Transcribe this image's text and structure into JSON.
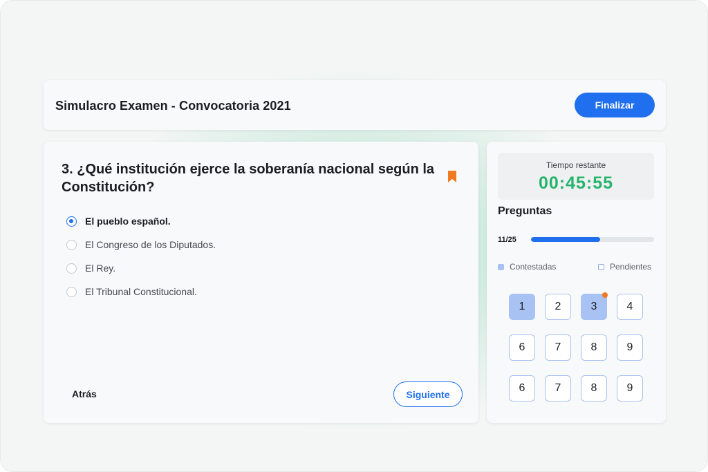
{
  "header": {
    "title": "Simulacro Examen - Convocatoria 2021",
    "finish_label": "Finalizar"
  },
  "question": {
    "text": "3. ¿Qué institución ejerce la soberanía nacional según la Constitución?",
    "bookmark_icon": "bookmark-icon",
    "options": [
      {
        "label": "El pueblo español.",
        "selected": true
      },
      {
        "label": "El Congreso de los Diputados.",
        "selected": false
      },
      {
        "label": "El Rey.",
        "selected": false
      },
      {
        "label": "El Tribunal Constitucional.",
        "selected": false
      }
    ],
    "back_label": "Atrás",
    "next_label": "Siguiente"
  },
  "sidebar": {
    "timer_label": "Tiempo restante",
    "timer_value": "00:45:55",
    "title": "Preguntas",
    "progress_label": "11/25",
    "progress_fraction": 0.56,
    "legend_answered": "Contestadas",
    "legend_pending": "Pendientes",
    "questions": [
      {
        "label": "1",
        "answered": true,
        "flagged": false
      },
      {
        "label": "2",
        "answered": false,
        "flagged": false
      },
      {
        "label": "3",
        "answered": true,
        "flagged": true
      },
      {
        "label": "4",
        "answered": false,
        "flagged": false
      },
      {
        "label": "6",
        "answered": false,
        "flagged": false
      },
      {
        "label": "7",
        "answered": false,
        "flagged": false
      },
      {
        "label": "8",
        "answered": false,
        "flagged": false
      },
      {
        "label": "9",
        "answered": false,
        "flagged": false
      },
      {
        "label": "6",
        "answered": false,
        "flagged": false
      },
      {
        "label": "7",
        "answered": false,
        "flagged": false
      },
      {
        "label": "8",
        "answered": false,
        "flagged": false
      },
      {
        "label": "9",
        "answered": false,
        "flagged": false
      }
    ]
  },
  "colors": {
    "accent": "#1f6fee",
    "timer": "#25b46b",
    "answered": "#a8c2f3",
    "flag": "#f07a22",
    "bookmark": "#f07a22"
  }
}
